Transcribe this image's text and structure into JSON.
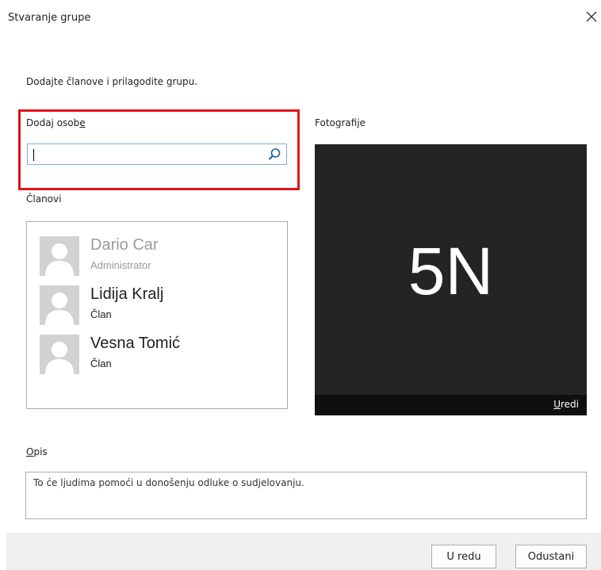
{
  "dialog": {
    "title": "Stvaranje grupe",
    "subtitle": "Dodajte članove i prilagodite grupu."
  },
  "add_people": {
    "label_pre": "Dodaj osob",
    "label_accel": "e",
    "value": ""
  },
  "members": {
    "label": "Članovi",
    "items": [
      {
        "name": "Dario Car",
        "role": "Administrator",
        "muted": true
      },
      {
        "name": "Lidija Kralj",
        "role": "Član",
        "muted": false
      },
      {
        "name": "Vesna Tomić",
        "role": "Član",
        "muted": false
      }
    ]
  },
  "photo": {
    "label": "Fotografije",
    "initials": "5N",
    "edit_accel": "U",
    "edit_rest": "redi"
  },
  "description": {
    "label_accel": "O",
    "label_rest": "pis",
    "placeholder": "To će ljudima pomoći u donošenju odluke o sudjelovanju."
  },
  "buttons": {
    "ok": "U redu",
    "cancel": "Odustani"
  },
  "colors": {
    "highlight": "#e0141a",
    "photo_bg": "#242424",
    "input_border": "#7aaed8"
  }
}
